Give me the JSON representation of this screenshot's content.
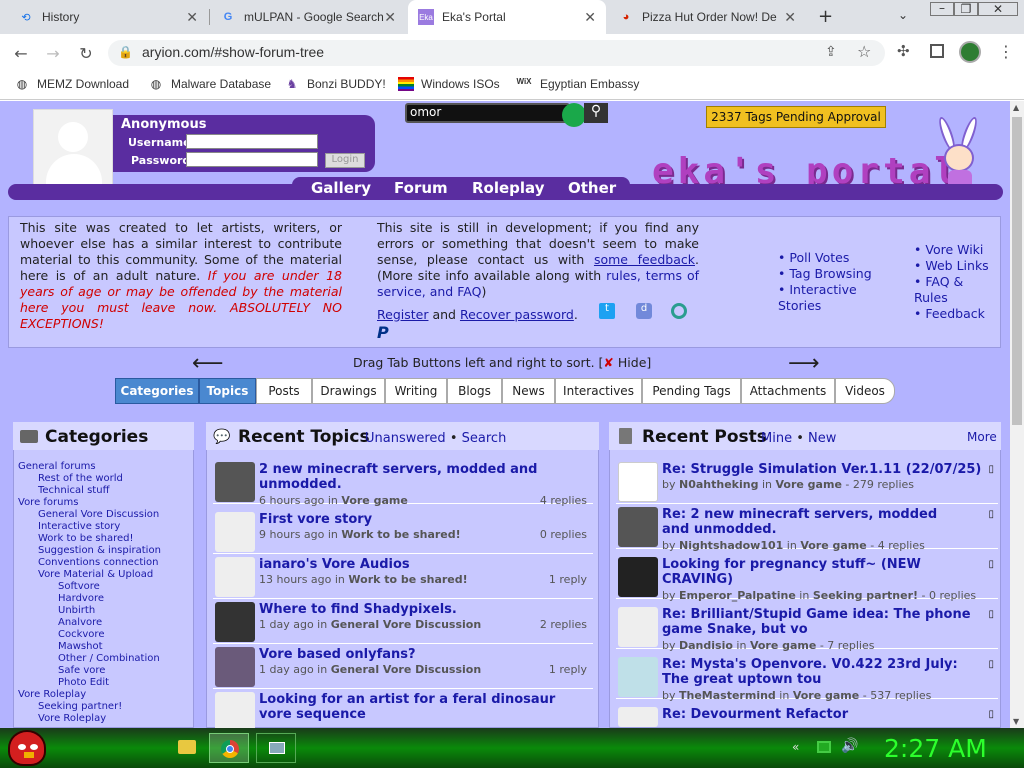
{
  "browser": {
    "tabs": [
      "History",
      "mULPAN - Google Search",
      "Eka's Portal",
      "Pizza Hut Order Now! De"
    ],
    "url": "aryion.com/#show-forum-tree",
    "bookmarks": [
      "MEMZ Download",
      "Malware Database",
      "Bonzi BUDDY!",
      "Windows ISOs",
      "Egyptian Embassy"
    ]
  },
  "header": {
    "user": "Anonymous",
    "username_label": "Username",
    "password_label": "Password",
    "login_label": "Login",
    "search_value": "omor",
    "tags_pending": "2337 Tags Pending Approval",
    "logo": "eka's portal",
    "nav": [
      "Gallery",
      "Forum",
      "Roleplay",
      "Other"
    ]
  },
  "info": {
    "p1a": "This site was created to let artists, writers, or whoever else has a similar interest to contribute material to this community. Some of the material here is of an adult nature.",
    "p1b": "If you are under 18 years of age or may be offended by the material here you must leave now. ABSOLUTELY NO EXCEPTIONS!",
    "p2a": "This site is still in development; if you find any errors or something that doesn't seem to make sense, please contact us with",
    "p2link": "some feedback",
    "p2b": ". (More site info available along with",
    "p2c": "rules, terms of service, and FAQ",
    "p2d": ")",
    "register": "Register",
    "and": "and",
    "recover": "Recover password",
    "links1": [
      "Poll Votes",
      "Tag Browsing",
      "Interactive Stories"
    ],
    "links2": [
      "Vore Wiki",
      "Web Links",
      "FAQ & Rules",
      "Feedback"
    ]
  },
  "tabsbar": {
    "hint": "Drag Tab Buttons left and right to sort. [",
    "hide": "Hide]",
    "tabs": [
      "Categories",
      "Topics",
      "Posts",
      "Drawings",
      "Writing",
      "Blogs",
      "News",
      "Interactives",
      "Pending Tags",
      "Attachments",
      "Videos"
    ]
  },
  "categories": {
    "title": "Categories",
    "items": [
      "General forums",
      "Rest of the world",
      "Technical stuff",
      "Vore forums",
      "General Vore Discussion",
      "Interactive story",
      "Work to be shared!",
      "Suggestion & inspiration",
      "Conventions connection",
      "Vore Material & Upload",
      "Softvore",
      "Hardvore",
      "Unbirth",
      "Analvore",
      "Cockvore",
      "Mawshot",
      "Other / Combination",
      "Safe vore",
      "Photo Edit",
      "Vore Roleplay",
      "Seeking partner!",
      "Vore Roleplay"
    ]
  },
  "topics": {
    "title": "Recent Topics",
    "unanswered": "Unanswered",
    "bullet": "•",
    "search": "Search",
    "items": [
      {
        "title": "2 new minecraft servers, modded and unmodded.",
        "time": "6 hours ago in",
        "forum": "Vore game",
        "replies": "4 replies"
      },
      {
        "title": "First vore story",
        "time": "9 hours ago in",
        "forum": "Work to be shared!",
        "replies": "0 replies"
      },
      {
        "title": "ianaro's Vore Audios",
        "time": "13 hours ago in",
        "forum": "Work to be shared!",
        "replies": "1 reply"
      },
      {
        "title": "Where to find Shadypixels.",
        "time": "1 day ago in",
        "forum": "General Vore Discussion",
        "replies": "2 replies"
      },
      {
        "title": "Vore based onlyfans?",
        "time": "1 day ago in",
        "forum": "General Vore Discussion",
        "replies": "1 reply"
      },
      {
        "title": "Looking for an artist for a feral dinosaur vore sequence",
        "time": "",
        "forum": "",
        "replies": ""
      }
    ]
  },
  "posts": {
    "title": "Recent Posts",
    "mine": "Mine",
    "bullet": "•",
    "new": "New",
    "more": "More",
    "items": [
      {
        "title": "Re: Struggle Simulation Ver.1.11 (22/07/25)",
        "by": "by",
        "user": "N0ahtheking",
        "in": "in",
        "forum": "Vore game",
        "replies": "- 279 replies"
      },
      {
        "title": "Re: 2 new minecraft servers, modded and unmodded.",
        "by": "by",
        "user": "Nightshadow101",
        "in": "in",
        "forum": "Vore game",
        "replies": "- 4 replies"
      },
      {
        "title": "Looking for pregnancy stuff~ (NEW CRAVING)",
        "by": "by",
        "user": "Emperor_Palpatine",
        "in": "in",
        "forum": "Seeking partner!",
        "replies": "- 0 replies"
      },
      {
        "title": "Re: Brilliant/Stupid Game idea: The phone game Snake, but vo",
        "by": "by",
        "user": "Dandisio",
        "in": "in",
        "forum": "Vore game",
        "replies": "- 7 replies"
      },
      {
        "title": "Re: Mysta's Openvore. V0.422 23rd July: The great uptown tou",
        "by": "by",
        "user": "TheMastermind",
        "in": "in",
        "forum": "Vore game",
        "replies": "- 537 replies"
      },
      {
        "title": "Re: Devourment Refactor",
        "by": "",
        "user": "",
        "in": "",
        "forum": "",
        "replies": ""
      }
    ]
  },
  "taskbar": {
    "time": "2:27 AM"
  }
}
